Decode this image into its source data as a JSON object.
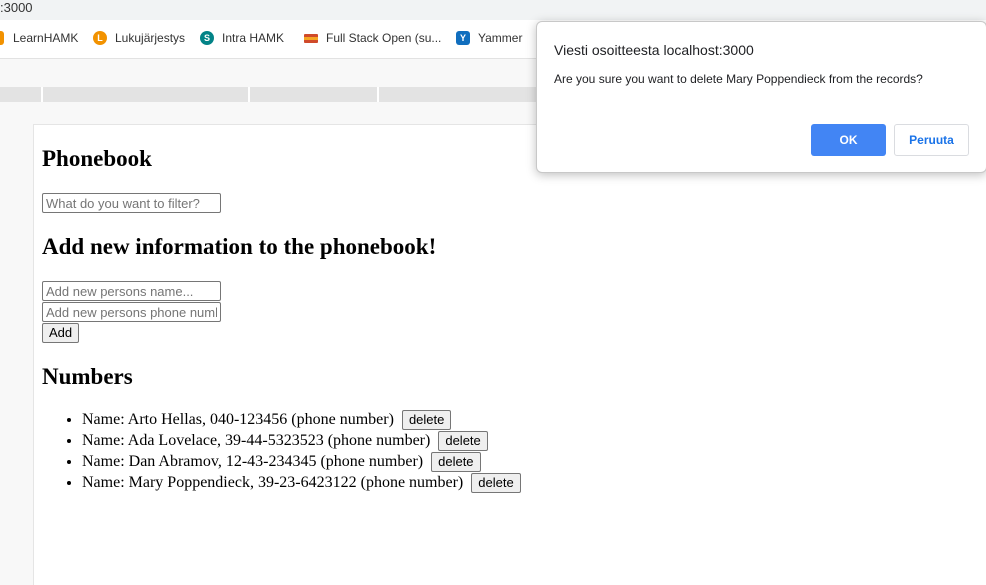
{
  "browser": {
    "address_fragment": ":3000",
    "bookmarks": [
      {
        "label": "LearnHAMK",
        "icon": "learnhamk-icon",
        "color": "#f29200"
      },
      {
        "label": "Lukujärjestys",
        "icon": "lukujarjestys-icon",
        "color": "#f29200"
      },
      {
        "label": "Intra HAMK",
        "icon": "sharepoint-icon",
        "color": "#038387"
      },
      {
        "label": "Full Stack Open (su...",
        "icon": "flag-icon",
        "color": "#d04a2a"
      },
      {
        "label": "Yammer",
        "icon": "yammer-icon",
        "color": "#106ebe"
      }
    ]
  },
  "app": {
    "title": "Phonebook",
    "filter_placeholder": "What do you want to filter?",
    "add_title": "Add new information to the phonebook!",
    "name_placeholder": "Add new persons name...",
    "phone_placeholder": "Add new persons phone number...",
    "add_label": "Add",
    "numbers_title": "Numbers",
    "persons": [
      {
        "text": "Name: Arto Hellas, 040-123456 (phone number)",
        "delete_label": "delete"
      },
      {
        "text": "Name: Ada Lovelace, 39-44-5323523 (phone number)",
        "delete_label": "delete"
      },
      {
        "text": "Name: Dan Abramov, 12-43-234345 (phone number)",
        "delete_label": "delete"
      },
      {
        "text": "Name: Mary Poppendieck, 39-23-6423122 (phone number)",
        "delete_label": "delete"
      }
    ]
  },
  "dialog": {
    "title": "Viesti osoitteesta localhost:3000",
    "message": "Are you sure you want to delete Mary Poppendieck from the records?",
    "ok_label": "OK",
    "cancel_label": "Peruuta",
    "ok_color": "#4285f4"
  }
}
